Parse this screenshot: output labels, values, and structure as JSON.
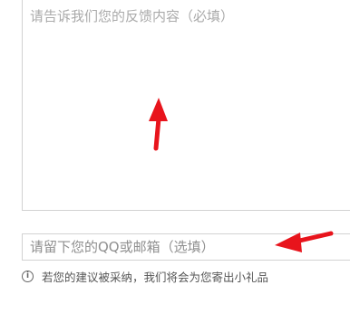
{
  "feedback": {
    "placeholder": "请告诉我们您的反馈内容（必填）",
    "value": ""
  },
  "contact": {
    "placeholder": "请留下您的QQ或邮箱（选填）",
    "value": ""
  },
  "notice": {
    "icon": "info-icon",
    "text": "若您的建议被采纳，我们将会为您寄出小礼品"
  },
  "colors": {
    "annotation": "#e8141c",
    "border": "#d2d2d2",
    "placeholder": "#aaaaaa"
  }
}
